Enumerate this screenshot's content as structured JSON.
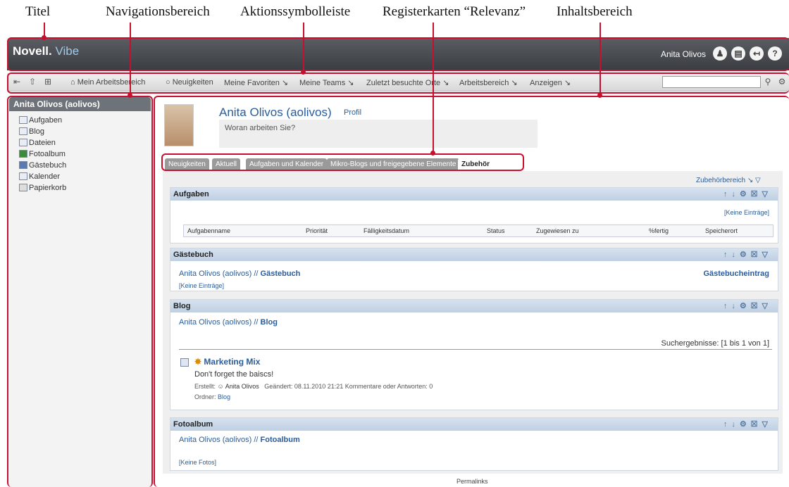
{
  "callouts": {
    "titel": "Titel",
    "navigation": "Navigationsbereich",
    "aktion": "Aktionssymbolleiste",
    "register": "Registerkarten “Relevanz”",
    "inhalt": "Inhaltsbereich"
  },
  "header": {
    "logo_novell": "Novell.",
    "logo_vibe": "Vibe",
    "user": "Anita Olivos"
  },
  "actionbar": {
    "items": [
      "Mein Arbeitsbereich",
      "Neuigkeiten",
      "Meine Favoriten",
      "Meine Teams",
      "Zuletzt besuchte Orte",
      "Arbeitsbereich",
      "Anzeigen"
    ],
    "search_placeholder": ""
  },
  "nav": {
    "title": "Anita Olivos (aolivos)",
    "items": [
      "Aufgaben",
      "Blog",
      "Dateien",
      "Fotoalbum",
      "Gästebuch",
      "Kalender",
      "Papierkorb"
    ]
  },
  "profile": {
    "name": "Anita Olivos (aolivos)",
    "profile_link": "Profil",
    "status_placeholder": "Woran arbeiten Sie?"
  },
  "tabs": [
    "Neuigkeiten",
    "Aktuell",
    "Aufgaben und Kalender",
    "Mikro-Blogs und freigegebene Elemente",
    "Zubehör"
  ],
  "accessory_area": "Zubehörbereich",
  "sections": {
    "aufgaben": {
      "title": "Aufgaben",
      "none": "[Keine Einträge]",
      "columns": [
        "Aufgabenname",
        "Priorität",
        "Fälligkeitsdatum",
        "Status",
        "Zugewiesen zu",
        "%fertig",
        "Speicherort"
      ]
    },
    "gaestebuch": {
      "title": "Gästebuch",
      "path": "Anita Olivos (aolivos) //",
      "path_bold": "Gästebuch",
      "action": "Gästebucheintrag",
      "none": "[Keine Einträge]"
    },
    "blog": {
      "title": "Blog",
      "path": "Anita Olivos (aolivos) //",
      "path_bold": "Blog",
      "results": "Suchergebnisse: [1 bis 1 von 1]",
      "entry_title": "Marketing Mix",
      "entry_text": "Don't forget the baiscs!",
      "created_label": "Erstellt:",
      "author": "Anita Olivos",
      "meta": "Geändert: 08.11.2010 21:21   Kommentare oder Antworten: 0",
      "folder_label": "Ordner:",
      "folder": "Blog"
    },
    "fotoalbum": {
      "title": "Fotoalbum",
      "path": "Anita Olivos (aolivos) //",
      "path_bold": "Fotoalbum",
      "none": "[Keine Fotos]"
    }
  },
  "footer": "Permalinks"
}
